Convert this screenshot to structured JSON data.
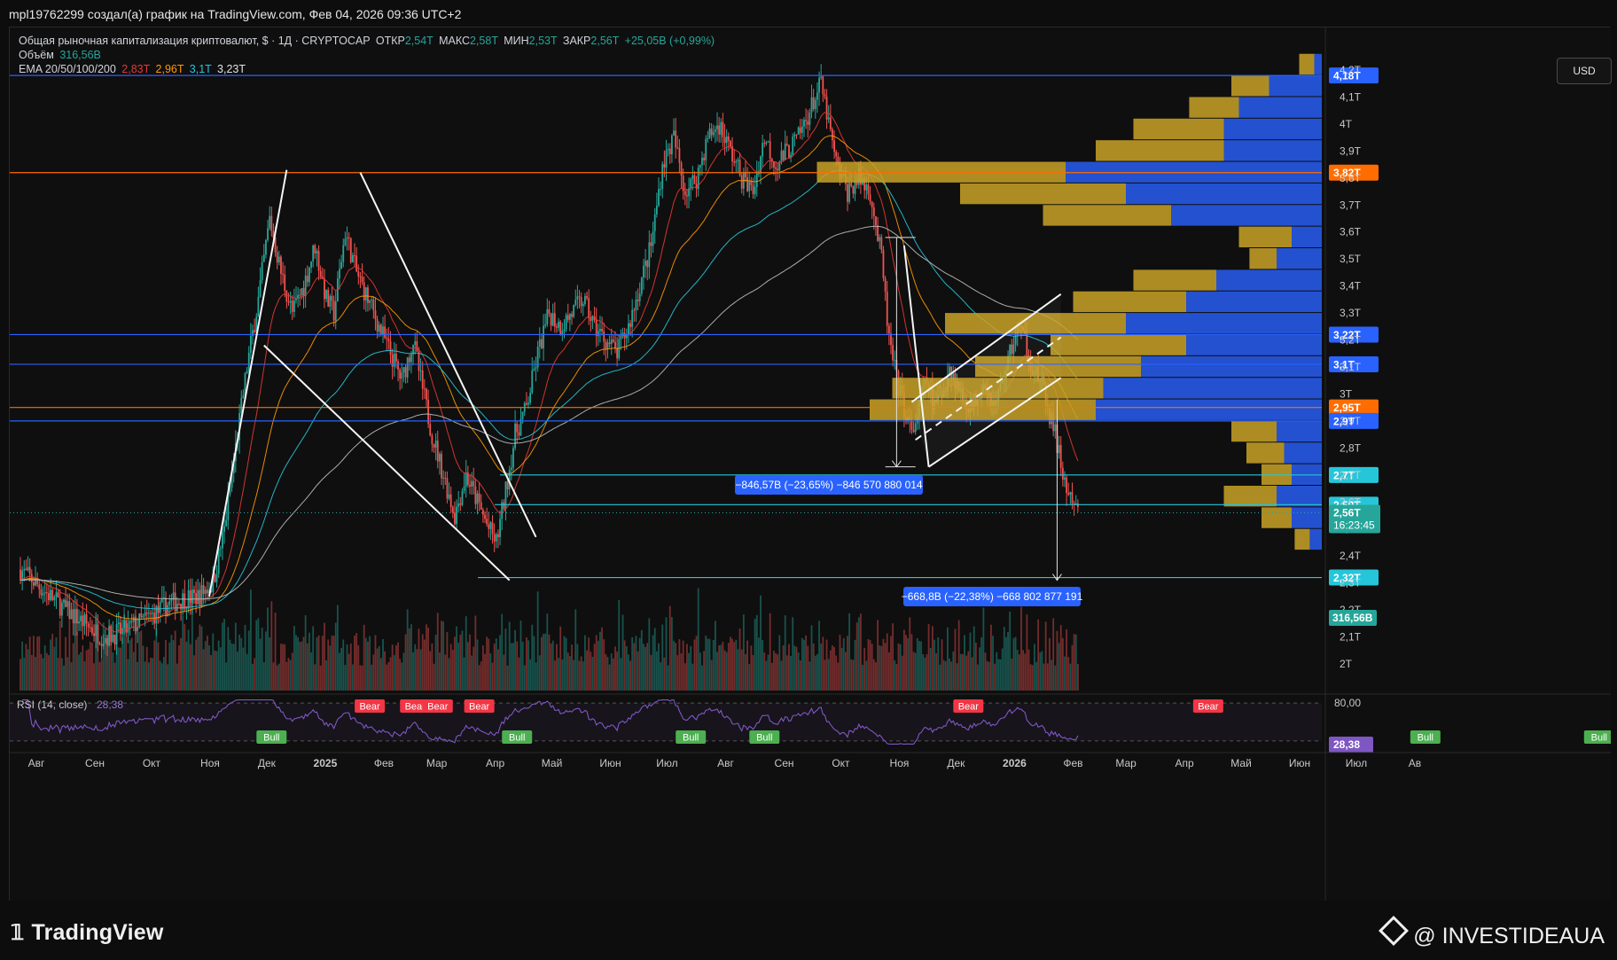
{
  "header": {
    "attribution": "mpl19762299 создал(а) график на TradingView.com, Фев 04, 2026 09:36 UTC+2"
  },
  "legend": {
    "title": "Общая рыночная капитализация криптовалют, $ · 1Д · CRYPTOCAP",
    "open_label": "ОТКР",
    "open": "2,54T",
    "high_label": "МАКС",
    "high": "2,58T",
    "low_label": "МИН",
    "low": "2,53T",
    "close_label": "ЗАКР",
    "close": "2,56T",
    "change": "+25,05B (+0,99%)",
    "volume_label": "Объём",
    "volume": "316,56B",
    "ema_label": "EMA 20/50/100/200",
    "ema20": "2,83T",
    "ema50": "2,96T",
    "ema100": "3,1T",
    "ema200": "3,23T"
  },
  "currency_button": "USD",
  "colors": {
    "up": "#26a69a",
    "down": "#ef5350",
    "ema20": "#e53935",
    "ema50": "#ff9800",
    "ema100": "#26c6da",
    "ema200": "#bdbdbd",
    "blue_line": "#2962ff",
    "orange_line": "#ff6d00",
    "cyan_line": "#26c6da",
    "vp_up": "#c9a227",
    "vp_down": "#2962ff",
    "rsi": "#7e57c2"
  },
  "measures": [
    {
      "text": "−846,57B (−23,65%) −846 570 880 014"
    },
    {
      "text": "−668,8B (−22,38%) −668 802 877 191"
    }
  ],
  "rsi": {
    "label": "RSI (14, close)",
    "value": "28,38",
    "upper": "80,00",
    "current": "28,38"
  },
  "rsi_signals": [
    {
      "text": "Bear",
      "type": "bear",
      "t": 185
    },
    {
      "text": "Bear",
      "type": "bear",
      "t": 209
    },
    {
      "text": "Bear",
      "type": "bear",
      "t": 221
    },
    {
      "text": "Bear",
      "type": "bear",
      "t": 243
    },
    {
      "text": "Bull",
      "type": "bull",
      "t": 133
    },
    {
      "text": "Bull",
      "type": "bull",
      "t": 263
    },
    {
      "text": "Bull",
      "type": "bull",
      "t": 355
    },
    {
      "text": "Bull",
      "type": "bull",
      "t": 394
    },
    {
      "text": "Bear",
      "type": "bear",
      "t": 502
    },
    {
      "text": "Bear",
      "type": "bear",
      "t": 629
    },
    {
      "text": "Bull",
      "type": "bull",
      "t": 744
    },
    {
      "text": "Bull",
      "type": "bull",
      "t": 836
    }
  ],
  "logo": "TradingView",
  "watermark": "@ INVESTIDEAUA",
  "chart_data": {
    "type": "candlestick",
    "title": "Общая рыночная капитализация криптовалют, $ · 1Д · CRYPTOCAP",
    "y_axis_ticks": [
      "4,2T",
      "4,1T",
      "4T",
      "3,9T",
      "3,8T",
      "3,7T",
      "3,6T",
      "3,5T",
      "3,4T",
      "3,3T",
      "3,2T",
      "3,1T",
      "3T",
      "2,9T",
      "2,8T",
      "2,7T",
      "2,6T",
      "2,5T",
      "2,4T",
      "2,3T",
      "2,2T",
      "2,1T",
      "2T"
    ],
    "y_axis_values": [
      4.2,
      4.1,
      4.0,
      3.9,
      3.8,
      3.7,
      3.6,
      3.5,
      3.4,
      3.3,
      3.2,
      3.1,
      3.0,
      2.9,
      2.8,
      2.7,
      2.6,
      2.5,
      2.4,
      2.3,
      2.2,
      2.1,
      2.0
    ],
    "ylim": [
      1.95,
      4.26
    ],
    "x_axis_ticks": [
      "Авг",
      "Сен",
      "Окт",
      "Ноя",
      "Дек",
      "2025",
      "Фев",
      "Мар",
      "Апр",
      "Май",
      "Июн",
      "Июл",
      "Авг",
      "Сен",
      "Окт",
      "Ноя",
      "Дек",
      "2026",
      "Фев",
      "Мар",
      "Апр",
      "Май",
      "Июн",
      "Июл",
      "Ав"
    ],
    "x_axis_bold": [
      false,
      false,
      false,
      false,
      false,
      true,
      false,
      false,
      false,
      false,
      false,
      false,
      false,
      false,
      false,
      false,
      false,
      true,
      false,
      false,
      false,
      false,
      false,
      false,
      false
    ],
    "x_axis_days": [
      0,
      31,
      61,
      92,
      122,
      153,
      184,
      212,
      243,
      273,
      304,
      334,
      365,
      396,
      426,
      457,
      487,
      518,
      549,
      577,
      608,
      638,
      669,
      699,
      730
    ],
    "date_range": [
      "2024-07-21",
      "2026-02-04"
    ],
    "price_path": [
      [
        0,
        2.35
      ],
      [
        8,
        2.3
      ],
      [
        16,
        2.25
      ],
      [
        24,
        2.2
      ],
      [
        34,
        2.15
      ],
      [
        44,
        2.1
      ],
      [
        54,
        2.12
      ],
      [
        62,
        2.15
      ],
      [
        70,
        2.18
      ],
      [
        78,
        2.22
      ],
      [
        86,
        2.24
      ],
      [
        94,
        2.25
      ],
      [
        102,
        2.3
      ],
      [
        108,
        2.5
      ],
      [
        114,
        2.8
      ],
      [
        120,
        3.1
      ],
      [
        126,
        3.35
      ],
      [
        132,
        3.65
      ],
      [
        138,
        3.45
      ],
      [
        144,
        3.3
      ],
      [
        150,
        3.4
      ],
      [
        156,
        3.55
      ],
      [
        162,
        3.35
      ],
      [
        166,
        3.3
      ],
      [
        172,
        3.6
      ],
      [
        178,
        3.45
      ],
      [
        184,
        3.35
      ],
      [
        190,
        3.25
      ],
      [
        196,
        3.15
      ],
      [
        202,
        3.05
      ],
      [
        208,
        3.2
      ],
      [
        212,
        3.05
      ],
      [
        218,
        2.85
      ],
      [
        224,
        2.7
      ],
      [
        230,
        2.55
      ],
      [
        236,
        2.7
      ],
      [
        242,
        2.6
      ],
      [
        248,
        2.5
      ],
      [
        252,
        2.45
      ],
      [
        256,
        2.6
      ],
      [
        262,
        2.85
      ],
      [
        268,
        2.95
      ],
      [
        274,
        3.15
      ],
      [
        280,
        3.3
      ],
      [
        286,
        3.25
      ],
      [
        292,
        3.3
      ],
      [
        298,
        3.35
      ],
      [
        304,
        3.25
      ],
      [
        310,
        3.2
      ],
      [
        316,
        3.15
      ],
      [
        322,
        3.25
      ],
      [
        328,
        3.4
      ],
      [
        334,
        3.55
      ],
      [
        340,
        3.85
      ],
      [
        346,
        3.95
      ],
      [
        352,
        3.75
      ],
      [
        358,
        3.8
      ],
      [
        364,
        3.95
      ],
      [
        370,
        4.0
      ],
      [
        376,
        3.9
      ],
      [
        382,
        3.8
      ],
      [
        388,
        3.75
      ],
      [
        394,
        3.95
      ],
      [
        400,
        3.85
      ],
      [
        406,
        3.9
      ],
      [
        412,
        3.95
      ],
      [
        418,
        4.05
      ],
      [
        424,
        4.15
      ],
      [
        428,
        4.0
      ],
      [
        432,
        3.85
      ],
      [
        438,
        3.75
      ],
      [
        444,
        3.8
      ],
      [
        450,
        3.75
      ],
      [
        456,
        3.5
      ],
      [
        460,
        3.2
      ],
      [
        464,
        3.05
      ],
      [
        468,
        2.95
      ],
      [
        472,
        2.85
      ],
      [
        476,
        2.95
      ],
      [
        480,
        3.05
      ],
      [
        484,
        2.95
      ],
      [
        488,
        3.0
      ],
      [
        492,
        3.1
      ],
      [
        498,
        3.0
      ],
      [
        504,
        2.95
      ],
      [
        510,
        3.05
      ],
      [
        516,
        2.95
      ],
      [
        520,
        3.05
      ],
      [
        524,
        3.15
      ],
      [
        528,
        3.25
      ],
      [
        532,
        3.2
      ],
      [
        536,
        3.1
      ],
      [
        540,
        3.05
      ],
      [
        544,
        2.95
      ],
      [
        548,
        2.85
      ],
      [
        552,
        2.7
      ],
      [
        556,
        2.6
      ],
      [
        560,
        2.56
      ]
    ],
    "volume": {
      "label": "Объём",
      "last": "316,56B"
    },
    "ema_series": [
      {
        "name": "EMA 20",
        "last": "2,83T"
      },
      {
        "name": "EMA 50",
        "last": "2,96T"
      },
      {
        "name": "EMA 100",
        "last": "3,1T"
      },
      {
        "name": "EMA 200",
        "last": "3,23T"
      }
    ],
    "horizontal_levels": [
      {
        "value": 4.18,
        "label": "4,18T",
        "color": "blue"
      },
      {
        "value": 3.82,
        "label": "3,82T",
        "color": "orange"
      },
      {
        "value": 3.22,
        "label": "3,22T",
        "color": "blue"
      },
      {
        "value": 3.11,
        "label": "3,1T",
        "color": "blue"
      },
      {
        "value": 2.95,
        "label": "2,95T",
        "color": "orange"
      },
      {
        "value": 2.9,
        "label": "2,9T",
        "color": "blue"
      },
      {
        "value": 2.7,
        "label": "2,7T",
        "color": "cyan"
      },
      {
        "value": 2.59,
        "label": "2,59T",
        "color": "cyan"
      },
      {
        "value": 2.32,
        "label": "2,32T",
        "color": "cyan"
      }
    ],
    "last_price": {
      "value": 2.56,
      "label": "2,56T",
      "countdown": "16:23:45"
    },
    "trend_lines": [
      {
        "from": [
          100,
          2.25
        ],
        "to": [
          141,
          3.83
        ]
      },
      {
        "from": [
          129,
          3.18
        ],
        "to": [
          259,
          2.31
        ]
      },
      {
        "from": [
          180,
          3.82
        ],
        "to": [
          273,
          2.47
        ]
      },
      {
        "from": [
          468,
          3.55
        ],
        "to": [
          481,
          2.73
        ]
      },
      {
        "from": [
          481,
          2.73
        ],
        "to": [
          551,
          3.06
        ]
      },
      {
        "from": [
          472,
          2.97
        ],
        "to": [
          551,
          3.37
        ]
      }
    ],
    "volume_profile": [
      {
        "price": 4.22,
        "up": 0.1,
        "down": 0.05
      },
      {
        "price": 4.14,
        "up": 0.25,
        "down": 0.35
      },
      {
        "price": 4.06,
        "up": 0.33,
        "down": 0.55
      },
      {
        "price": 3.98,
        "up": 0.6,
        "down": 0.65
      },
      {
        "price": 3.9,
        "up": 0.85,
        "down": 0.65
      },
      {
        "price": 3.82,
        "up": 1.65,
        "down": 1.7
      },
      {
        "price": 3.74,
        "up": 1.1,
        "down": 1.3
      },
      {
        "price": 3.66,
        "up": 0.85,
        "down": 1.0
      },
      {
        "price": 3.58,
        "up": 0.35,
        "down": 0.2
      },
      {
        "price": 3.5,
        "up": 0.18,
        "down": 0.3
      },
      {
        "price": 3.42,
        "up": 0.55,
        "down": 0.7
      },
      {
        "price": 3.34,
        "up": 0.75,
        "down": 0.9
      },
      {
        "price": 3.26,
        "up": 1.2,
        "down": 1.3
      },
      {
        "price": 3.18,
        "up": 0.9,
        "down": 0.9
      },
      {
        "price": 3.1,
        "up": 1.1,
        "down": 1.2
      },
      {
        "price": 3.02,
        "up": 1.4,
        "down": 1.45
      },
      {
        "price": 2.94,
        "up": 1.5,
        "down": 1.5
      },
      {
        "price": 2.86,
        "up": 0.3,
        "down": 0.3
      },
      {
        "price": 2.78,
        "up": 0.25,
        "down": 0.25
      },
      {
        "price": 2.7,
        "up": 0.2,
        "down": 0.2
      },
      {
        "price": 2.62,
        "up": 0.35,
        "down": 0.3
      },
      {
        "price": 2.54,
        "up": 0.2,
        "down": 0.2
      },
      {
        "price": 2.46,
        "up": 0.1,
        "down": 0.08
      }
    ],
    "rsi_series": {
      "name": "RSI (14, close)",
      "last": 28.38,
      "overbought": 80,
      "oversold": 20
    },
    "grid": false,
    "legend_position": "top-left"
  }
}
